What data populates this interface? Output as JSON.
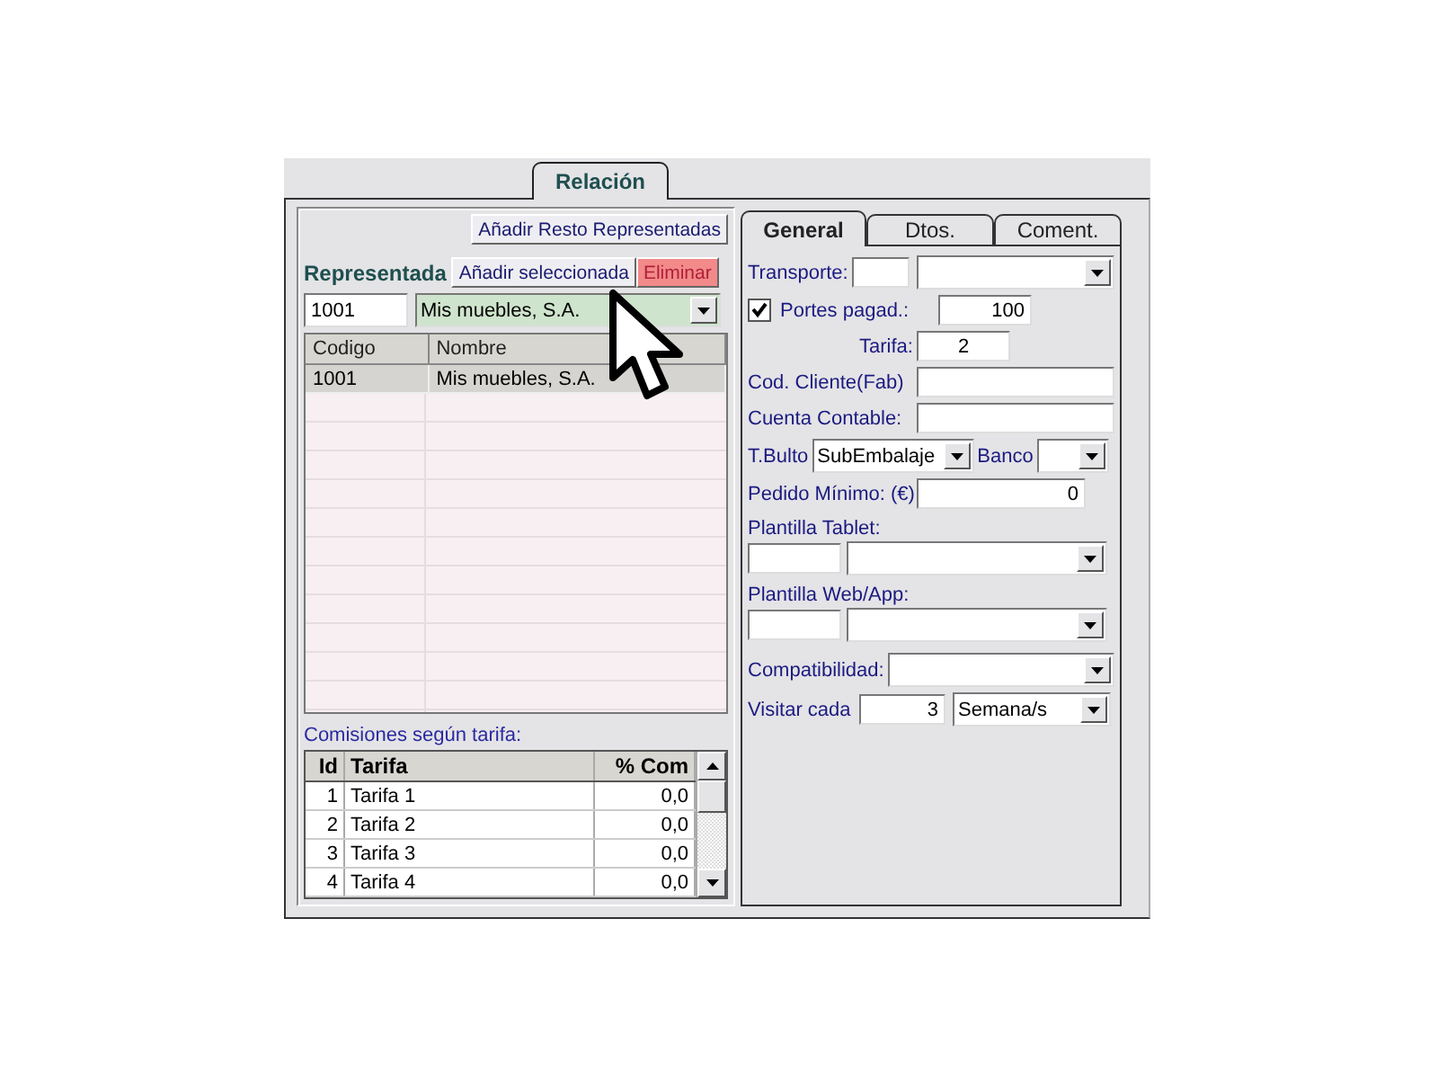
{
  "window": {
    "tabs": [
      {
        "label": "Relación",
        "selected": true
      }
    ]
  },
  "representadas": {
    "add_rest_button": "Añadir Resto Representadas",
    "label": "Representada",
    "add_selected_button": "Añadir seleccionada",
    "delete_button": "Eliminar",
    "code": "1001",
    "name": "Mis muebles, S.A.",
    "columns": [
      "Codigo",
      "Nombre"
    ],
    "rows": [
      {
        "cells": [
          "1001",
          "Mis muebles, S.A."
        ],
        "selected": true
      }
    ]
  },
  "commissions": {
    "title": "Comisiones según tarifa:",
    "columns": [
      "Id",
      "Tarifa",
      "% Com"
    ],
    "rows": [
      [
        "1",
        "Tarifa 1",
        "0,0"
      ],
      [
        "2",
        "Tarifa 2",
        "0,0"
      ],
      [
        "3",
        "Tarifa 3",
        "0,0"
      ],
      [
        "4",
        "Tarifa 4",
        "0,0"
      ]
    ]
  },
  "detail": {
    "tabs": [
      {
        "label": "General",
        "selected": true
      },
      {
        "label": "Dtos.",
        "selected": false
      },
      {
        "label": "Coment.",
        "selected": false
      }
    ],
    "fields": [
      {
        "kind": "code_combo",
        "label": "Transporte:"
      },
      {
        "kind": "check_number",
        "label": "Portes pagad.:",
        "checked": true,
        "value": "100"
      },
      {
        "kind": "number",
        "label": "Tarifa:",
        "value": "2"
      },
      {
        "kind": "text",
        "label": "Cod. Cliente(Fab)"
      },
      {
        "kind": "text",
        "label": "Cuenta Contable:"
      },
      {
        "kind": "pair_combo",
        "label": "T.Bulto",
        "value": "SubEmbalaje",
        "label2": "Banco"
      },
      {
        "kind": "amount",
        "label": "Pedido Mínimo: (€)",
        "value": "0"
      },
      {
        "kind": "stacked",
        "label": "Plantilla Tablet:"
      },
      {
        "kind": "stacked",
        "label": "Plantilla Web/App:"
      },
      {
        "kind": "combo",
        "label": "Compatibilidad:"
      },
      {
        "kind": "number_combo",
        "label": "Visitar cada",
        "value": "3",
        "value2": "Semana/s"
      }
    ]
  }
}
